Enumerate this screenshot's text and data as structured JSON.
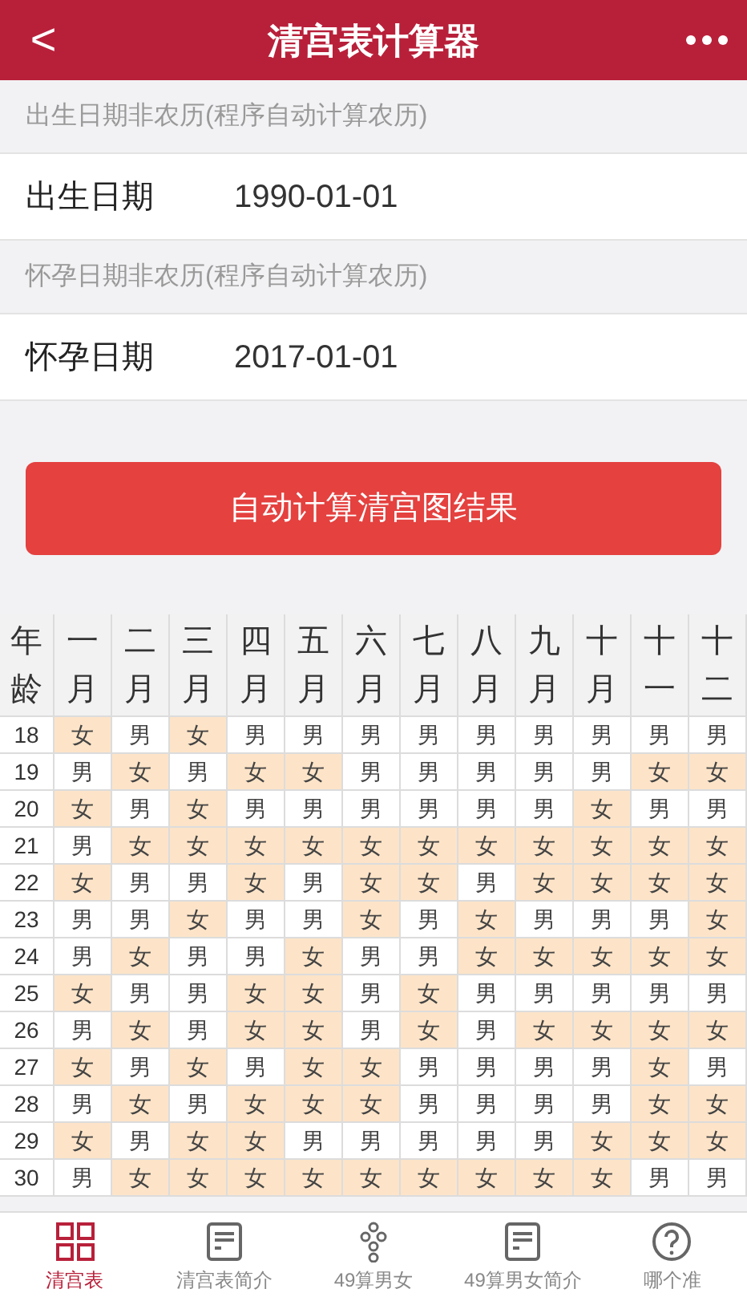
{
  "header": {
    "title": "清宫表计算器",
    "back": "<"
  },
  "sections": [
    {
      "note": "出生日期非农历(程序自动计算农历)",
      "label": "出生日期",
      "value": "1990-01-01"
    },
    {
      "note": "怀孕日期非农历(程序自动计算农历)",
      "label": "怀孕日期",
      "value": "2017-01-01"
    }
  ],
  "button": "自动计算清宫图结果",
  "table": {
    "columns": [
      "年龄",
      "一月",
      "二月",
      "三月",
      "四月",
      "五月",
      "六月",
      "七月",
      "八月",
      "九月",
      "十月",
      "十一",
      "十二"
    ],
    "rows": [
      {
        "cells": [
          "18",
          "女",
          "男",
          "女",
          "男",
          "男",
          "男",
          "男",
          "男",
          "男",
          "男",
          "男",
          "男"
        ],
        "highlighted": [
          false,
          true,
          false,
          true,
          false,
          false,
          false,
          false,
          false,
          false,
          false,
          false,
          false
        ]
      },
      {
        "cells": [
          "19",
          "男",
          "女",
          "男",
          "女",
          "女",
          "男",
          "男",
          "男",
          "男",
          "男",
          "女",
          "女"
        ],
        "highlighted": [
          false,
          false,
          true,
          false,
          true,
          true,
          false,
          false,
          false,
          false,
          false,
          true,
          true
        ]
      },
      {
        "cells": [
          "20",
          "女",
          "男",
          "女",
          "男",
          "男",
          "男",
          "男",
          "男",
          "男",
          "女",
          "男",
          "男"
        ],
        "highlighted": [
          false,
          true,
          false,
          true,
          false,
          false,
          false,
          false,
          false,
          false,
          true,
          false,
          false
        ]
      },
      {
        "cells": [
          "21",
          "男",
          "女",
          "女",
          "女",
          "女",
          "女",
          "女",
          "女",
          "女",
          "女",
          "女",
          "女"
        ],
        "highlighted": [
          false,
          false,
          true,
          true,
          true,
          true,
          true,
          true,
          true,
          true,
          true,
          true,
          true
        ]
      },
      {
        "cells": [
          "22",
          "女",
          "男",
          "男",
          "女",
          "男",
          "女",
          "女",
          "男",
          "女",
          "女",
          "女",
          "女"
        ],
        "highlighted": [
          false,
          true,
          false,
          false,
          true,
          false,
          true,
          true,
          false,
          true,
          true,
          true,
          true
        ]
      },
      {
        "cells": [
          "23",
          "男",
          "男",
          "女",
          "男",
          "男",
          "女",
          "男",
          "女",
          "男",
          "男",
          "男",
          "女"
        ],
        "highlighted": [
          false,
          false,
          false,
          true,
          false,
          false,
          true,
          false,
          true,
          false,
          false,
          false,
          true
        ]
      },
      {
        "cells": [
          "24",
          "男",
          "女",
          "男",
          "男",
          "女",
          "男",
          "男",
          "女",
          "女",
          "女",
          "女",
          "女"
        ],
        "highlighted": [
          false,
          false,
          true,
          false,
          false,
          true,
          false,
          false,
          true,
          true,
          true,
          true,
          true
        ]
      },
      {
        "cells": [
          "25",
          "女",
          "男",
          "男",
          "女",
          "女",
          "男",
          "女",
          "男",
          "男",
          "男",
          "男",
          "男"
        ],
        "highlighted": [
          false,
          true,
          false,
          false,
          true,
          true,
          false,
          true,
          false,
          false,
          false,
          false,
          false
        ]
      },
      {
        "cells": [
          "26",
          "男",
          "女",
          "男",
          "女",
          "女",
          "男",
          "女",
          "男",
          "女",
          "女",
          "女",
          "女"
        ],
        "highlighted": [
          false,
          false,
          true,
          false,
          true,
          true,
          false,
          true,
          false,
          true,
          true,
          true,
          true
        ]
      },
      {
        "cells": [
          "27",
          "女",
          "男",
          "女",
          "男",
          "女",
          "女",
          "男",
          "男",
          "男",
          "男",
          "女",
          "男"
        ],
        "highlighted": [
          false,
          true,
          false,
          true,
          false,
          true,
          true,
          false,
          false,
          false,
          false,
          true,
          false
        ]
      },
      {
        "cells": [
          "28",
          "男",
          "女",
          "男",
          "女",
          "女",
          "女",
          "男",
          "男",
          "男",
          "男",
          "女",
          "女"
        ],
        "highlighted": [
          false,
          false,
          true,
          false,
          true,
          true,
          true,
          false,
          false,
          false,
          false,
          true,
          true
        ]
      },
      {
        "cells": [
          "29",
          "女",
          "男",
          "女",
          "女",
          "男",
          "男",
          "男",
          "男",
          "男",
          "女",
          "女",
          "女"
        ],
        "highlighted": [
          false,
          true,
          false,
          true,
          true,
          false,
          false,
          false,
          false,
          false,
          true,
          true,
          true
        ]
      },
      {
        "cells": [
          "30",
          "男",
          "女",
          "女",
          "女",
          "女",
          "女",
          "女",
          "女",
          "女",
          "女",
          "男",
          "男"
        ],
        "highlighted": [
          false,
          false,
          true,
          true,
          true,
          true,
          true,
          true,
          true,
          true,
          true,
          false,
          false
        ]
      }
    ]
  },
  "tab_bar": [
    {
      "label": "清宫表",
      "kind": "grid",
      "selected": true
    },
    {
      "label": "清宫表简介",
      "kind": "doc",
      "selected": false
    },
    {
      "label": "49算男女",
      "kind": "dots",
      "selected": false
    },
    {
      "label": "49算男女简介",
      "kind": "doc",
      "selected": false
    },
    {
      "label": "哪个准",
      "kind": "help",
      "selected": false
    }
  ]
}
